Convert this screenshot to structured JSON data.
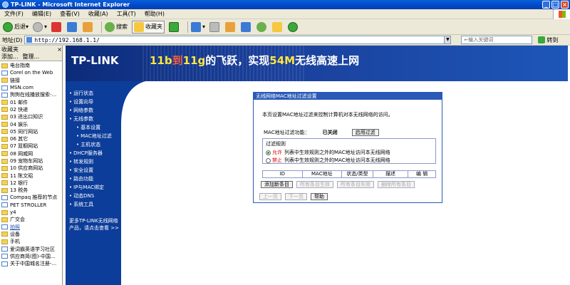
{
  "window": {
    "title": "TP-LINK - Microsoft Internet Explorer"
  },
  "menu": [
    "文件(F)",
    "编辑(E)",
    "查看(V)",
    "收藏(A)",
    "工具(T)",
    "帮助(H)"
  ],
  "toolbar": {
    "back": "后退",
    "search": "搜索",
    "favorites": "收藏夹"
  },
  "address": {
    "label": "地址(D)",
    "url": "http://192.168.1.1/",
    "search_placeholder": "←输入关键词",
    "go": "转到"
  },
  "favorites": {
    "header": "收藏夹",
    "add": "添加...",
    "organize": "整理...",
    "items": [
      {
        "type": "folder",
        "label": "电台指南"
      },
      {
        "type": "page",
        "label": "Corel on the Web"
      },
      {
        "type": "folder",
        "label": "链接"
      },
      {
        "type": "page",
        "label": "MSN.com"
      },
      {
        "type": "page",
        "label": "狗狗在线播放搜索-..."
      },
      {
        "type": "folder",
        "label": "01 邮件"
      },
      {
        "type": "folder",
        "label": "02 快递"
      },
      {
        "type": "folder",
        "label": "03 进出口知识"
      },
      {
        "type": "folder",
        "label": "04 娱乐"
      },
      {
        "type": "folder",
        "label": "05 同行网站"
      },
      {
        "type": "folder",
        "label": "06 其它"
      },
      {
        "type": "folder",
        "label": "07 篮橱网站"
      },
      {
        "type": "folder",
        "label": "08 网威网"
      },
      {
        "type": "folder",
        "label": "09 宠物车网站"
      },
      {
        "type": "folder",
        "label": "10 供应商网站"
      },
      {
        "type": "folder",
        "label": "11 陈文昭"
      },
      {
        "type": "folder",
        "label": "12 银行"
      },
      {
        "type": "folder",
        "label": "13 税务"
      },
      {
        "type": "page",
        "label": "Compaq 推荐的节点"
      },
      {
        "type": "page",
        "label": "PET STROLLER"
      },
      {
        "type": "folder",
        "label": "y4"
      },
      {
        "type": "folder",
        "label": "广交会"
      },
      {
        "type": "page",
        "label": "拍照",
        "selected": true
      },
      {
        "type": "folder",
        "label": "设备"
      },
      {
        "type": "folder",
        "label": "手机"
      },
      {
        "type": "page",
        "label": "爱词霸英语学习社区"
      },
      {
        "type": "page",
        "label": "供应商简(图)-中国..."
      },
      {
        "type": "page",
        "label": "关于中国城名注册-..."
      }
    ]
  },
  "banner": {
    "logo": "TP-LINK",
    "slogan_a": "11b",
    "slogan_b": "到",
    "slogan_c": "11g",
    "slogan_d": "的飞跃，实现",
    "slogan_e": "54M",
    "slogan_f": "无线高速上网"
  },
  "nav": [
    {
      "label": "运行状态",
      "sub": false
    },
    {
      "label": "设置向导",
      "sub": false
    },
    {
      "label": "网络参数",
      "sub": false
    },
    {
      "label": "无线参数",
      "sub": false
    },
    {
      "label": "基本设置",
      "sub": true
    },
    {
      "label": "MAC地址过滤",
      "sub": true
    },
    {
      "label": "主机状态",
      "sub": true
    },
    {
      "label": "DHCP服务器",
      "sub": false
    },
    {
      "label": "转发规则",
      "sub": false
    },
    {
      "label": "安全设置",
      "sub": false
    },
    {
      "label": "路由功能",
      "sub": false
    },
    {
      "label": "IP与MAC绑定",
      "sub": false
    },
    {
      "label": "动态DNS",
      "sub": false
    },
    {
      "label": "系统工具",
      "sub": false
    }
  ],
  "nav_more": {
    "line1": "更多TP-LINK无线网络",
    "line2": "产品，请点击查看 >>"
  },
  "dialog": {
    "title": "无线网络MAC地址过滤设置",
    "description": "本页设置MAC地址过滤来控制计算机对本无线网络的访问。",
    "filter_label": "MAC地址过滤功能：",
    "filter_status": "已关闭",
    "enable_button": "启用过滤",
    "rules_legend": "过滤规则",
    "rule_allow_tag": "允许",
    "rule_allow_text": "列表中生效规则之外的MAC地址访问本无线网络",
    "rule_deny_tag": "禁止",
    "rule_deny_text": "列表中生效规则之外的MAC地址访问本无线网络",
    "table_headers": [
      "ID",
      "MAC地址",
      "状态/类型",
      "描述",
      "编 辑"
    ],
    "buttons": [
      "添加新条目",
      "所有条目生效",
      "所有条目失效",
      "删除所有条目"
    ],
    "nav_buttons": [
      "上一页",
      "下一页",
      "帮助"
    ]
  }
}
